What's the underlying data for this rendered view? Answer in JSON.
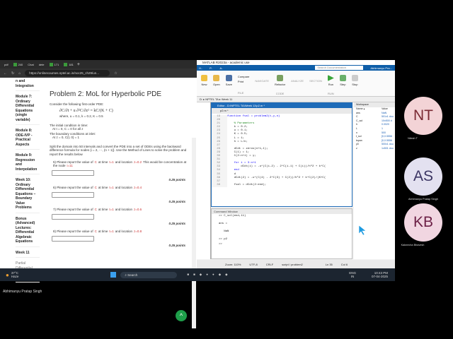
{
  "browser": {
    "tabs": [
      "pdf",
      "240",
      "Chat",
      "dete",
      "171",
      "181"
    ],
    "url": "https://onlinecourses.nptel.ac.in/noc25_ch29/un...",
    "sidebar": [
      "n and Integration",
      "Module 7: Ordinary Differential Equations (single variable)",
      "Module 8: ODE-IVP - Practical Aspects",
      "Module 9: Regression and Interpolation",
      "Week 10: Ordinary Differential Equations – Boundary Value Problems",
      "Bonus (Advanced) Lectures: Differential Algebraic Equations",
      "Week 11"
    ],
    "sidebar_sub": "Partial Differential Equations (PDEs)",
    "title": "Problem 2: MoL for Hyperbolic PDE",
    "intro": "Consider the following first-order PDE:",
    "equation": "∂C/∂t + u ∂²C/∂z² = kC/(K + C)",
    "params": "where,  u = 0.1, k = 0.2, K = 0.5",
    "ic_label": "The initial condition in time:",
    "ic": "At t = 0,   C = 0 for all z",
    "bc_label": "The boundary conditions at inlet:",
    "bc": "At z = 0, C(t, 0) = 1",
    "instructions": "Split the domain into 50 intervals and convert the PDE into a set of ODEs using the backward difference formula for nodes {i = 2, ⋯, (n + 1)}. Use the Method of Lines to solve the problem and report the results below",
    "questions": [
      {
        "n": "5)",
        "t": "t=1",
        "z": "z=0.2",
        "extra": "This would be concentration at the node",
        "node": "i=11",
        "points": "0.25 points"
      },
      {
        "n": "6)",
        "t": "t=1",
        "z": "z=0.4",
        "points": "0.25 points"
      },
      {
        "n": "7)",
        "t": "t=1",
        "z": "z=0.6",
        "points": "0.25 points"
      },
      {
        "n": "8)",
        "t": "t=1",
        "z": "z=0.8",
        "points": "0.25 points"
      }
    ],
    "q_text": "Please report the value of",
    "q_var": "C",
    "q_at": "at time",
    "q_loc": "and location"
  },
  "taskbar": {
    "weather": "37°C",
    "weather_sub": "Haze",
    "search": "Search",
    "lang": "ENG",
    "region": "IN",
    "time": "10:43 PM",
    "date": "07-04-2025"
  },
  "matlab": {
    "title": "MATLAB R2023a - academic use",
    "search_placeholder": "Search Documentation",
    "user": "Abhimanyu Pra...",
    "toolstrip": [
      "New",
      "Open",
      "Save",
      "Compare",
      "Print",
      "NAVIGATE",
      "Refactor",
      "ANALYZE",
      "SECTION",
      "Run",
      "Step",
      "Stop"
    ],
    "sections": [
      "FILE",
      "CODE",
      "RUN"
    ],
    "path": "D: ▸ NPTEL TA ▸ Week 11",
    "editor_title": "Editor - D:\\NPTEL TA\\Week 11\\p2.m *",
    "editor_tab": "p2.m *",
    "code": [
      {
        "n": "19",
        "t": "function fval = problem2(t,y,n)"
      },
      {
        "n": "20",
        "t": ""
      },
      {
        "n": "21",
        "t": "    % Parameters"
      },
      {
        "n": "22",
        "t": "    k = 0.2;"
      },
      {
        "n": "23",
        "t": "    u = 0.1;"
      },
      {
        "n": "24",
        "t": "    K = 0.5;"
      },
      {
        "n": "25",
        "t": "    L = 1;"
      },
      {
        "n": "26",
        "t": "    h = L/n;"
      },
      {
        "n": "27",
        "t": ""
      },
      {
        "n": "28",
        "t": "    dCdt = zeros(n+1,1);"
      },
      {
        "n": "29",
        "t": "    C(1) = 1;"
      },
      {
        "n": "30",
        "t": "    C(2:n+1) = y;"
      },
      {
        "n": "31",
        "t": ""
      },
      {
        "n": "32",
        "t": "    for i = 3:n+1"
      },
      {
        "n": "33",
        "t": "        dCdt(i) = -u*(C(i-2) - 2*C(i-1) + C(i))/h^2 + k*C("
      },
      {
        "n": "34",
        "t": "    end"
      },
      {
        "n": "35",
        "t": "    d"
      },
      {
        "n": "36",
        "t": "    dCdt(2) = -u*(C(4) - 2*C(3) + C(2))/h^2 + k*C(2)/(K+C("
      },
      {
        "n": "37",
        "t": ""
      },
      {
        "n": "38",
        "t": "    fval = dCdt(2:end);"
      }
    ],
    "command_title": "Command Window",
    "command": [
      ">> C_sol(end,11)",
      "",
      "ans =",
      "",
      "   NaN",
      "",
      ">> p2",
      ">>"
    ],
    "workspace_title": "Workspace",
    "ws_cols": [
      "Name ▴",
      "Value"
    ],
    "workspace": [
      [
        "ans",
        "NaN"
      ],
      [
        "C",
        "501x1 dou"
      ],
      [
        "C_sol",
        "10x500 d"
      ],
      [
        "h",
        "0.0020"
      ],
      [
        "L",
        "1"
      ],
      [
        "n",
        "500"
      ],
      [
        "t_sol",
        "[0,0.5556"
      ],
      [
        "tspan",
        "[0,0.5556"
      ],
      [
        "y0",
        "500x1 dou"
      ],
      [
        "z",
        "1x501 dou"
      ]
    ],
    "status": [
      "Zoom: 110%",
      "UTF-8",
      "CRLF",
      "script / problem2",
      "Ln  35",
      "Col  6"
    ]
  },
  "participants": [
    {
      "initials": "NT",
      "name": "Nilesh T",
      "bg": "#f3d3d6",
      "fg": "#7a2a33"
    },
    {
      "initials": "AS",
      "name": "Abhimanyu Pratap Singh",
      "bg": "#e3e1f0",
      "fg": "#3b3563"
    },
    {
      "initials": "KB",
      "name": "Kaknecha Bhavesh",
      "bg": "#f1d6e1",
      "fg": "#6b1f45"
    }
  ],
  "presenter": "Abhimanyu Pratap Singh"
}
